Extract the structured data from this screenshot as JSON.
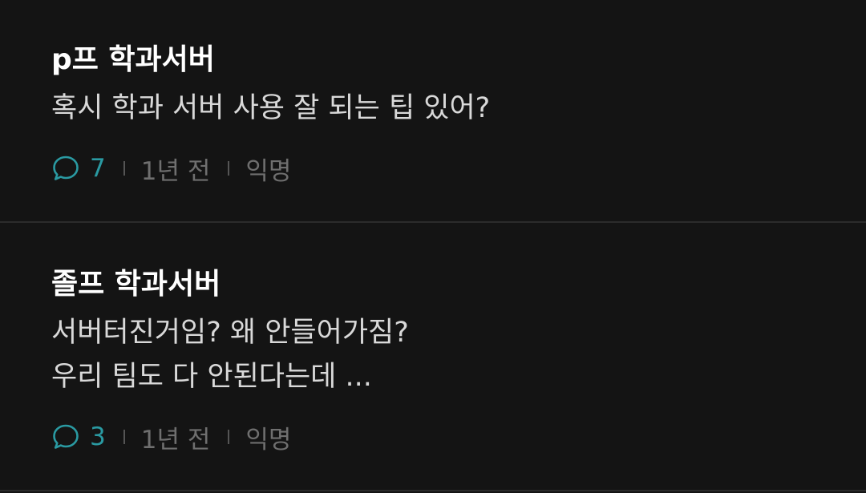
{
  "posts": [
    {
      "title": "p프 학과서버",
      "body": [
        "혹시 학과 서버 사용 잘 되는 팁 있어?"
      ],
      "comments": "7",
      "time": "1년 전",
      "author": "익명"
    },
    {
      "title": "졸프 학과서버",
      "body": [
        "서버터진거임? 왜 안들어가짐?",
        "우리 팀도 다 안된다는데 ..."
      ],
      "comments": "3",
      "time": "1년 전",
      "author": "익명"
    }
  ],
  "colors": {
    "background": "#141414",
    "accent": "#2a9aa2",
    "meta_text": "#6f6f6f",
    "divider": "#2b2b2b"
  },
  "icons": {
    "comment": "comment-bubble-icon"
  }
}
